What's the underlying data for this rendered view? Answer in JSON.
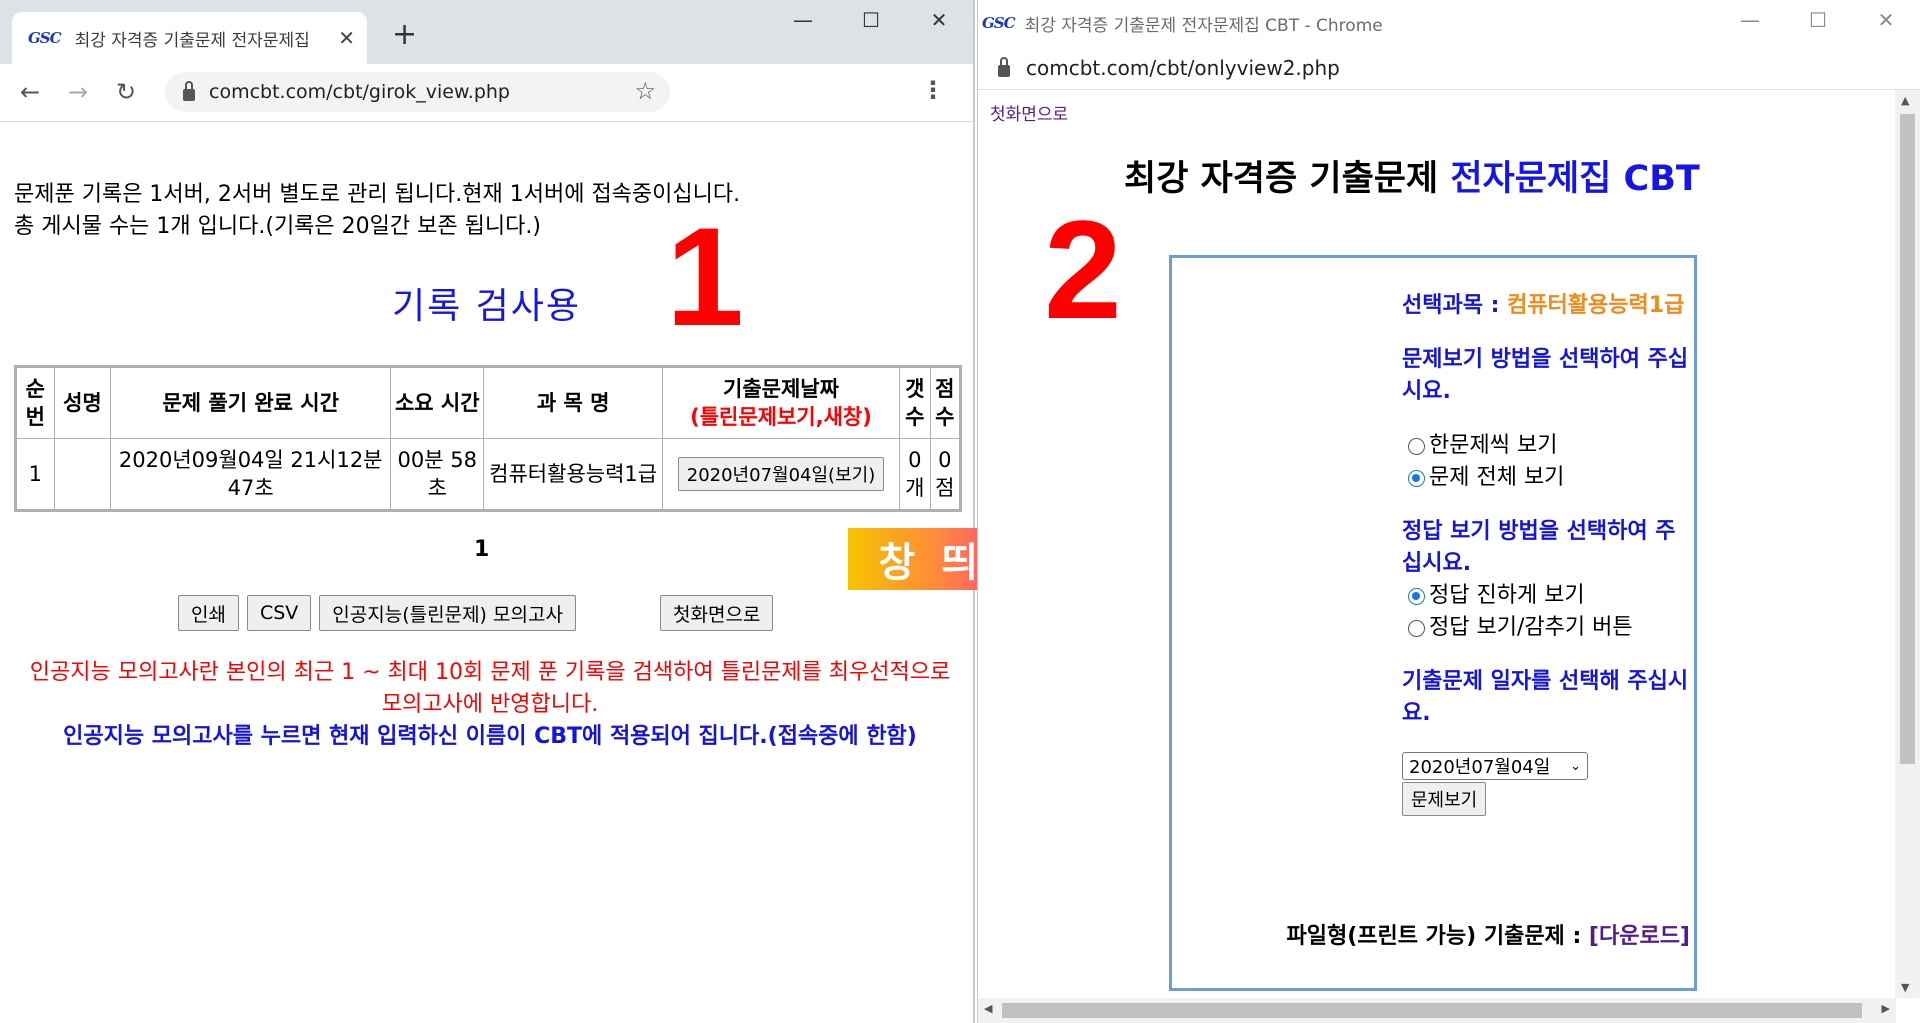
{
  "win1": {
    "favicon": "GSC",
    "tab_title": "최강 자격증 기출문제 전자문제집",
    "new_tab": "+",
    "url": "comcbt.com/cbt/girok_view.php",
    "info_line1": "문제푼 기록은 1서버, 2서버 별도로 관리 됩니다.현재 1서버에 접속중이십니다.",
    "info_line2": "총 게시물 수는 1개 입니다.(기록은 20일간 보존 됩니다.)",
    "page_title": "기록 검사용",
    "marker": "1",
    "table": {
      "headers": {
        "no": "순번",
        "name": "성명",
        "finish_time": "문제 풀기 완료 시간",
        "duration": "소요 시간",
        "subject": "과 목 명",
        "exam_date": "기출문제날짜",
        "exam_date_note": "(틀린문제보기,새창)",
        "count": "갯수",
        "score": "점수"
      },
      "rows": [
        {
          "no": "1",
          "name": "",
          "finish_time": "2020년09월04일 21시12분47초",
          "duration": "00분 58초",
          "subject": "컴퓨터활용능력1급",
          "exam_date_button": "2020년07월04일(보기)",
          "count": "0개",
          "score": "0점"
        }
      ]
    },
    "pager": "1",
    "buttons": {
      "print": "인쇄",
      "csv": "CSV",
      "ai_exam": "인공지능(틀린문제) 모의고사",
      "home": "첫화면으로"
    },
    "ai_note_red": "인공지능 모의고사란 본인의 최근 1 ~ 최대 10회 문제 푼 기록을 검색하여 틀린문제를 최우선적으로 모의고사에 반영합니다.",
    "ai_note_blue": "인공지능 모의고사를 누르면 현재 입력하신 이름이 CBT에 적용되어 집니다.(접속중에 한함)"
  },
  "banner": "창 띄우기",
  "win2": {
    "favicon": "GSC",
    "window_title": "최강 자격증 기출문제 전자문제집 CBT - Chrome",
    "url": "comcbt.com/cbt/onlyview2.php",
    "home_link": "첫화면으로",
    "title_black": "최강 자격증 기출문제 ",
    "title_blue": "전자문제집 CBT",
    "marker": "2",
    "subject_label": "선택과목 : ",
    "subject_value": "컴퓨터활용능력1급",
    "view_method_label": "문제보기 방법을 선택하여 주십시요.",
    "view_options": [
      "한문제씩 보기",
      "문제 전체 보기"
    ],
    "view_selected": 1,
    "answer_method_label": "정답 보기 방법을 선택하여 주십시요.",
    "answer_options": [
      "정답 진하게 보기",
      "정답 보기/감추기 버튼"
    ],
    "answer_selected": 0,
    "date_label": "기출문제 일자를 선택해 주십시요.",
    "date_select": "2020년07월04일",
    "view_button": "문제보기",
    "file_label": "파일형(프린트 가능) 기출문제 : ",
    "download_link": "[다운로드]"
  },
  "colors": {
    "marker_red": "#ff0000",
    "title_blue": "#1515e6",
    "label_blue": "#1414dd",
    "subject_orange": "#f08a1a",
    "link_purple": "#551a8b",
    "panel_border": "#6a9fd0"
  },
  "icons": [
    "back-arrow-icon",
    "forward-arrow-icon",
    "reload-icon",
    "lock-icon",
    "star-icon",
    "kebab-menu-icon",
    "minimize-icon",
    "maximize-icon",
    "close-icon"
  ]
}
